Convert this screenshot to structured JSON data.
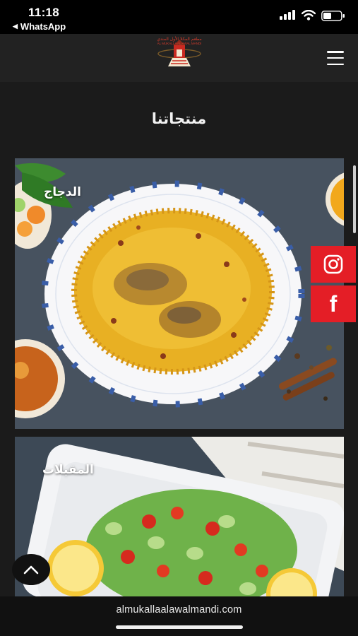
{
  "status_bar": {
    "time": "11:18",
    "back_app_label": "WhatsApp",
    "icons": [
      "signal-icon",
      "wifi-icon",
      "battery-icon"
    ]
  },
  "header": {
    "logo_text_ar": "مطعم المكلا الأول المندي",
    "logo_text_en": "AL MUKALLA AL AWAL MANDI",
    "menu_icon": "hamburger-menu-icon"
  },
  "main": {
    "section_title": "منتجاتنا",
    "products": [
      {
        "label": "الدجاج"
      },
      {
        "label": "المقبلات"
      }
    ]
  },
  "social": {
    "instagram_icon": "instagram-icon",
    "facebook_glyph": "f"
  },
  "browser": {
    "url": "almukallaalawalmandi.com"
  },
  "colors": {
    "accent_red": "#e41e26",
    "background": "#1b1b1b",
    "header_bg": "#222222",
    "rice_yellow": "#e8b023"
  }
}
